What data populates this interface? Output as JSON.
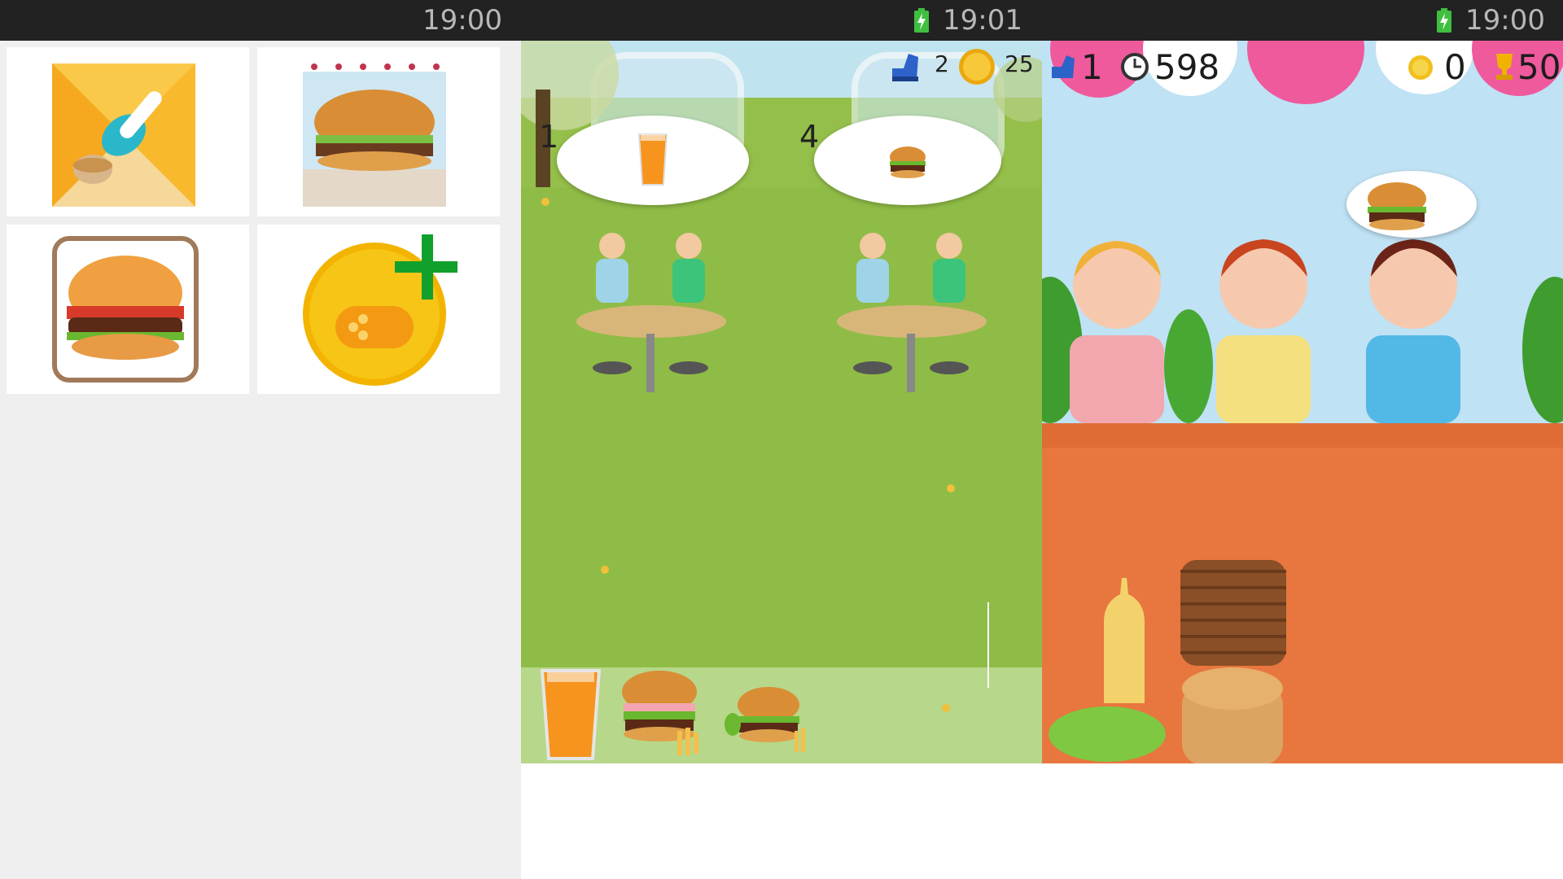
{
  "status_bar": {
    "time_left": "19:00",
    "time_middle": "19:01",
    "time_right": "19:00",
    "battery_icon": "battery-charging-icon",
    "battery_color": "#3fbf3f"
  },
  "app_tiles": [
    {
      "icon": "burger-rocket-icon"
    },
    {
      "icon": "burger-shop-icon"
    },
    {
      "icon": "burger-square-icon"
    },
    {
      "icon": "gamepad-plus-icon"
    }
  ],
  "park_game": {
    "hud": {
      "level_value": "2",
      "coins_value": "25"
    },
    "tables": [
      {
        "number": "1",
        "order_icon": "orange-juice-icon"
      },
      {
        "number": "4",
        "order_icon": "burger-icon"
      }
    ],
    "tray_items": [
      "orange-juice-icon",
      "burger-fries-icon",
      "burger-salad-icon"
    ],
    "colors": {
      "grass": "#8fbc46",
      "sky": "#bfe3ef"
    }
  },
  "kitchen_game": {
    "hud": {
      "level_value": "1",
      "timer_value": "598",
      "coins_value": "0",
      "trophy_value": "50"
    },
    "customer_order_icon": "burger-icon",
    "colors": {
      "counter": "#e8763f",
      "wall": "#bfe2f4",
      "balloon": "#ef5a9d"
    }
  }
}
